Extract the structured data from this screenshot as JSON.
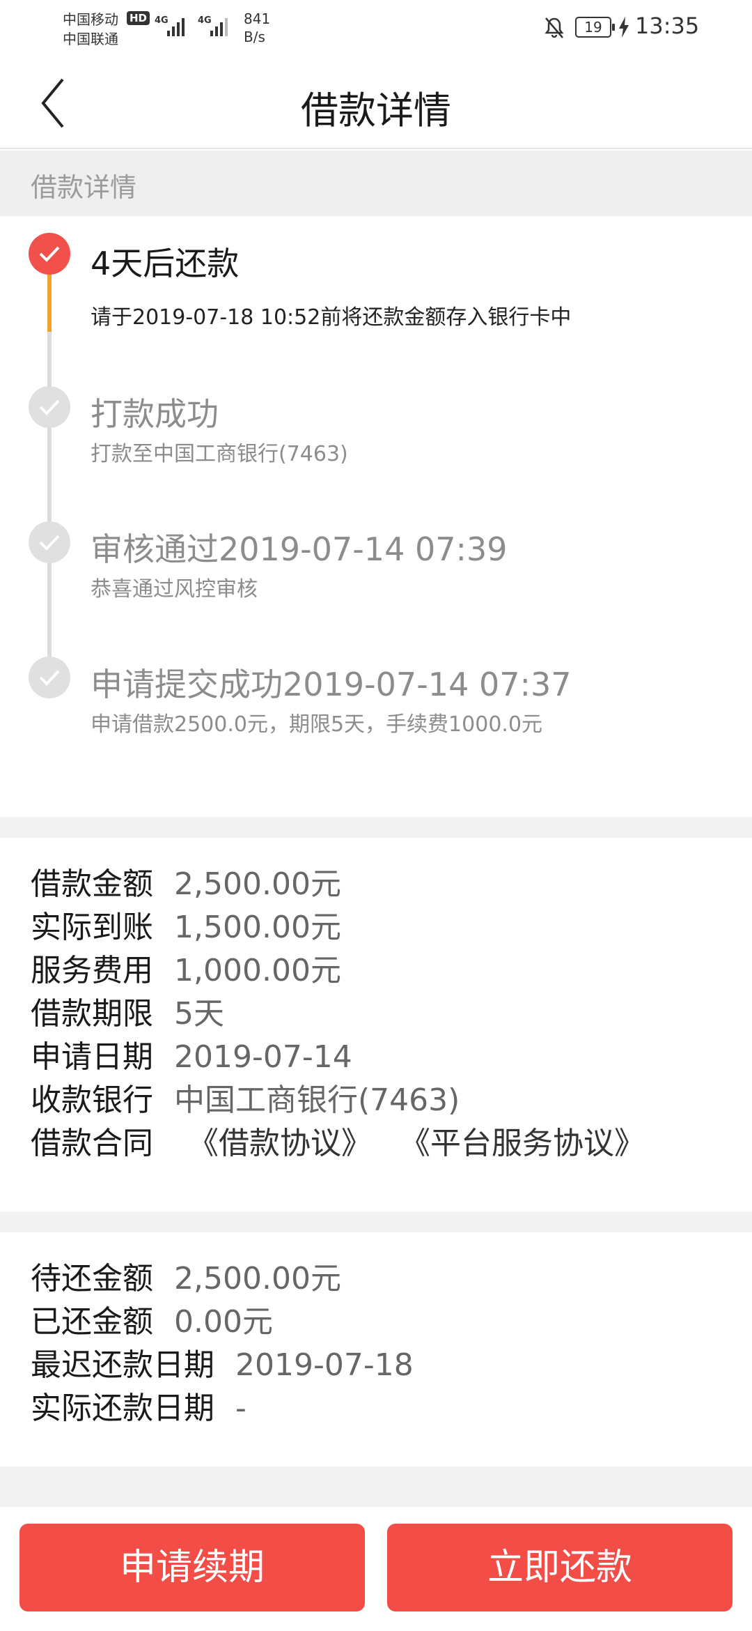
{
  "status_bar": {
    "carrier1": "中国移动",
    "carrier2": "中国联通",
    "hd": "HD",
    "net1": "4G",
    "net2": "4G",
    "speed_value": "841",
    "speed_unit": "B/s",
    "battery": "19",
    "time": "13:35"
  },
  "nav": {
    "title": "借款详情"
  },
  "section": {
    "header": "借款详情"
  },
  "timeline": [
    {
      "title": "4天后还款",
      "sub": "请于2019-07-18 10:52前将还款金额存入银行卡中"
    },
    {
      "title": "打款成功",
      "sub": "打款至中国工商银行(7463)"
    },
    {
      "title": "审核通过2019-07-14 07:39",
      "sub": "恭喜通过风控审核"
    },
    {
      "title": "申请提交成功2019-07-14 07:37",
      "sub": "申请借款2500.0元，期限5天，手续费1000.0元"
    }
  ],
  "loan_details": {
    "amount": {
      "label": "借款金额",
      "value": "2,500.00元"
    },
    "received": {
      "label": "实际到账",
      "value": "1,500.00元"
    },
    "fee": {
      "label": "服务费用",
      "value": "1,000.00元"
    },
    "term": {
      "label": "借款期限",
      "value": "5天"
    },
    "apply_date": {
      "label": "申请日期",
      "value": "2019-07-14"
    },
    "bank": {
      "label": "收款银行",
      "value": "中国工商银行(7463)"
    },
    "contract": {
      "label": "借款合同",
      "link1": "《借款协议》",
      "link2": "《平台服务协议》"
    }
  },
  "repayment": {
    "pending": {
      "label": "待还金额",
      "value": "2,500.00元"
    },
    "paid": {
      "label": "已还金额",
      "value": "0.00元"
    },
    "latest_date": {
      "label": "最迟还款日期",
      "value": "2019-07-18"
    },
    "actual_date": {
      "label": "实际还款日期",
      "value": "-"
    }
  },
  "buttons": {
    "renew": "申请续期",
    "repay": "立即还款"
  },
  "colors": {
    "accent": "#f24d47",
    "progress": "#f0a32a",
    "inactive": "#e0e0e0"
  }
}
